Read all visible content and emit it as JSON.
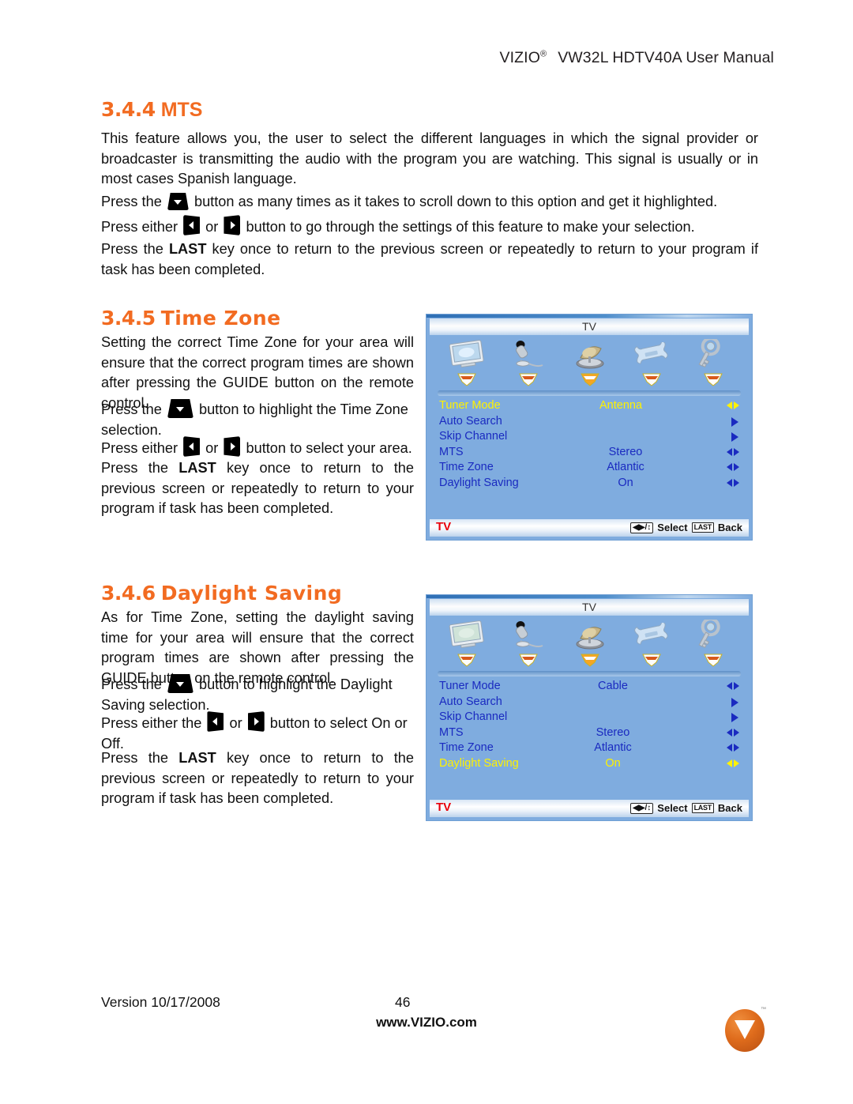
{
  "header": {
    "brand": "VIZIO",
    "registered": "®",
    "title": "VW32L HDTV40A User Manual"
  },
  "sections": [
    {
      "number": "3.4.4",
      "title": "MTS",
      "paragraphs": [
        "This feature allows you, the user to select the different languages in which the signal provider or broadcaster is transmitting the audio with the program you are watching. This signal is usually or in most cases Spanish language.",
        "Press the",
        "button as many times as it takes to scroll down to this option and get it highlighted.",
        "Press either",
        "or",
        "button to go through the settings of this feature to make your selection.",
        "Press the",
        "LAST",
        "key once to return to the previous screen or repeatedly to return to your program if task has been completed."
      ]
    },
    {
      "number": "3.4.5",
      "title": "Time Zone",
      "p_intro": "Setting the correct Time Zone for your area will ensure that the correct program times are shown after pressing the GUIDE button on the remote control.",
      "p_press_the": "Press the",
      "p_press_the_tail": "button to highlight the Time Zone selection.",
      "p_press_either": "Press either",
      "p_or": "or",
      "p_press_either_tail": "button to select your area.",
      "p_last_head": "Press the",
      "p_last_key": "LAST",
      "p_last_tail": "key once to return to the previous screen or repeatedly to return to your program if task has been completed."
    },
    {
      "number": "3.4.6",
      "title": "Daylight Saving",
      "p_intro": "As for Time Zone, setting the daylight saving time for your area will ensure that the correct program times are shown after pressing the GUIDE button on the remote control.",
      "p_press_the": "Press the",
      "p_press_the_tail": "button to highlight the Daylight Saving selection.",
      "p_press_either": "Press either the",
      "p_or": "or",
      "p_press_either_tail": "button to select On or Off.",
      "p_last_head": "Press the",
      "p_last_key": "LAST",
      "p_last_tail": "key once to return to the previous screen or repeatedly to return to your program if task has been completed."
    }
  ],
  "osd_menus": [
    {
      "name": "tuner-mode-menu",
      "title": "TV",
      "tabs": [
        {
          "name": "picture-icon",
          "label": "Picture"
        },
        {
          "name": "audio-icon",
          "label": "Audio"
        },
        {
          "name": "tv-tuner-icon",
          "label": "TV"
        },
        {
          "name": "setup-icon",
          "label": "Setup"
        },
        {
          "name": "parental-icon",
          "label": "Parental"
        }
      ],
      "active_tab_index": 2,
      "rows": [
        {
          "label": "Tuner Mode",
          "value": "Antenna",
          "arrow": "left-right",
          "selected": true
        },
        {
          "label": "Auto Search",
          "value": "",
          "arrow": "right",
          "selected": false
        },
        {
          "label": "Skip Channel",
          "value": "",
          "arrow": "right",
          "selected": false
        },
        {
          "label": "MTS",
          "value": "Stereo",
          "arrow": "left-right",
          "selected": false
        },
        {
          "label": "Time Zone",
          "value": "Atlantic",
          "arrow": "left-right",
          "selected": false
        },
        {
          "label": "Daylight Saving",
          "value": "On",
          "arrow": "left-right",
          "selected": false
        }
      ],
      "footer": {
        "source": "TV",
        "nav_hint": "◀▶/↕",
        "select_label": "Select",
        "last_key": "LAST",
        "back_label": "Back"
      }
    },
    {
      "name": "daylight-saving-menu",
      "title": "TV",
      "tabs": [
        {
          "name": "picture-icon",
          "label": "Picture"
        },
        {
          "name": "audio-icon",
          "label": "Audio"
        },
        {
          "name": "tv-tuner-icon",
          "label": "TV"
        },
        {
          "name": "setup-icon",
          "label": "Setup"
        },
        {
          "name": "parental-icon",
          "label": "Parental"
        }
      ],
      "active_tab_index": 2,
      "rows": [
        {
          "label": "Tuner Mode",
          "value": "Cable",
          "arrow": "left-right",
          "selected": false
        },
        {
          "label": "Auto Search",
          "value": "",
          "arrow": "right",
          "selected": false
        },
        {
          "label": "Skip Channel",
          "value": "",
          "arrow": "right",
          "selected": false
        },
        {
          "label": "MTS",
          "value": "Stereo",
          "arrow": "left-right",
          "selected": false
        },
        {
          "label": "Time Zone",
          "value": "Atlantic",
          "arrow": "left-right",
          "selected": false
        },
        {
          "label": "Daylight Saving",
          "value": "On",
          "arrow": "left-right",
          "selected": true
        }
      ],
      "footer": {
        "source": "TV",
        "nav_hint": "◀▶/↕",
        "select_label": "Select",
        "last_key": "LAST",
        "back_label": "Back"
      }
    }
  ],
  "footer": {
    "version": "Version 10/17/2008",
    "page_number": "46",
    "url": "www.VIZIO.com",
    "logo_letter": "V"
  },
  "colors": {
    "heading_orange": "#F26B21",
    "osd_background": "#7FACDF",
    "osd_text_blue": "#1A2AC0",
    "osd_highlight_yellow": "#FFF200",
    "osd_source_red": "#E8000B",
    "logo_orange": "#DF6C1C"
  }
}
